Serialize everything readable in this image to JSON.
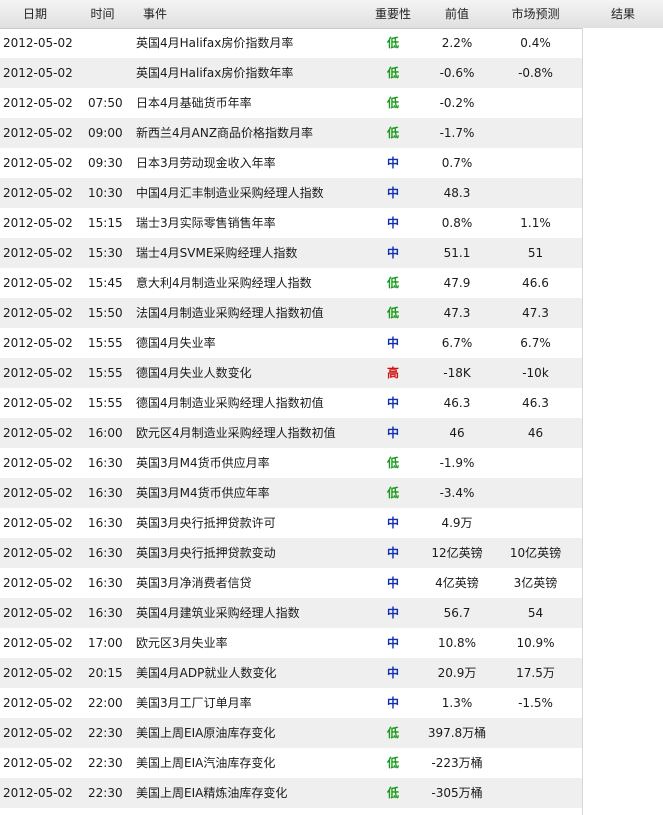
{
  "header": {
    "date": "日期",
    "time": "时间",
    "event": "事件",
    "importance": "重要性",
    "previous": "前值",
    "forecast": "市场预测",
    "result": "结果"
  },
  "colors": {
    "low": "#1a9a1a",
    "mid": "#1030b0",
    "high": "#d01010",
    "row_alt": "#efefef"
  },
  "rows": [
    {
      "date": "2012-05-02",
      "time": "",
      "event": "英国4月Halifax房价指数月率",
      "importance": "低",
      "level": "low",
      "previous": "2.2%",
      "forecast": "0.4%"
    },
    {
      "date": "2012-05-02",
      "time": "",
      "event": "英国4月Halifax房价指数年率",
      "importance": "低",
      "level": "low",
      "previous": "-0.6%",
      "forecast": "-0.8%"
    },
    {
      "date": "2012-05-02",
      "time": "07:50",
      "event": "日本4月基础货币年率",
      "importance": "低",
      "level": "low",
      "previous": "-0.2%",
      "forecast": ""
    },
    {
      "date": "2012-05-02",
      "time": "09:00",
      "event": "新西兰4月ANZ商品价格指数月率",
      "importance": "低",
      "level": "low",
      "previous": "-1.7%",
      "forecast": ""
    },
    {
      "date": "2012-05-02",
      "time": "09:30",
      "event": "日本3月劳动现金收入年率",
      "importance": "中",
      "level": "mid",
      "previous": "0.7%",
      "forecast": ""
    },
    {
      "date": "2012-05-02",
      "time": "10:30",
      "event": "中国4月汇丰制造业采购经理人指数",
      "importance": "中",
      "level": "mid",
      "previous": "48.3",
      "forecast": ""
    },
    {
      "date": "2012-05-02",
      "time": "15:15",
      "event": "瑞士3月实际零售销售年率",
      "importance": "中",
      "level": "mid",
      "previous": "0.8%",
      "forecast": "1.1%"
    },
    {
      "date": "2012-05-02",
      "time": "15:30",
      "event": "瑞士4月SVME采购经理人指数",
      "importance": "中",
      "level": "mid",
      "previous": "51.1",
      "forecast": "51"
    },
    {
      "date": "2012-05-02",
      "time": "15:45",
      "event": "意大利4月制造业采购经理人指数",
      "importance": "低",
      "level": "low",
      "previous": "47.9",
      "forecast": "46.6"
    },
    {
      "date": "2012-05-02",
      "time": "15:50",
      "event": "法国4月制造业采购经理人指数初值",
      "importance": "低",
      "level": "low",
      "previous": "47.3",
      "forecast": "47.3"
    },
    {
      "date": "2012-05-02",
      "time": "15:55",
      "event": "德国4月失业率",
      "importance": "中",
      "level": "mid",
      "previous": "6.7%",
      "forecast": "6.7%"
    },
    {
      "date": "2012-05-02",
      "time": "15:55",
      "event": "德国4月失业人数变化",
      "importance": "高",
      "level": "high",
      "previous": "-18K",
      "forecast": "-10k"
    },
    {
      "date": "2012-05-02",
      "time": "15:55",
      "event": "德国4月制造业采购经理人指数初值",
      "importance": "中",
      "level": "mid",
      "previous": "46.3",
      "forecast": "46.3"
    },
    {
      "date": "2012-05-02",
      "time": "16:00",
      "event": "欧元区4月制造业采购经理人指数初值",
      "importance": "中",
      "level": "mid",
      "previous": "46",
      "forecast": "46"
    },
    {
      "date": "2012-05-02",
      "time": "16:30",
      "event": "英国3月M4货币供应月率",
      "importance": "低",
      "level": "low",
      "previous": "-1.9%",
      "forecast": ""
    },
    {
      "date": "2012-05-02",
      "time": "16:30",
      "event": "英国3月M4货币供应年率",
      "importance": "低",
      "level": "low",
      "previous": "-3.4%",
      "forecast": ""
    },
    {
      "date": "2012-05-02",
      "time": "16:30",
      "event": "英国3月央行抵押贷款许可",
      "importance": "中",
      "level": "mid",
      "previous": "4.9万",
      "forecast": ""
    },
    {
      "date": "2012-05-02",
      "time": "16:30",
      "event": "英国3月央行抵押贷款变动",
      "importance": "中",
      "level": "mid",
      "previous": "12亿英镑",
      "forecast": "10亿英镑"
    },
    {
      "date": "2012-05-02",
      "time": "16:30",
      "event": "英国3月净消费者信贷",
      "importance": "中",
      "level": "mid",
      "previous": "4亿英镑",
      "forecast": "3亿英镑"
    },
    {
      "date": "2012-05-02",
      "time": "16:30",
      "event": "英国4月建筑业采购经理人指数",
      "importance": "中",
      "level": "mid",
      "previous": "56.7",
      "forecast": "54"
    },
    {
      "date": "2012-05-02",
      "time": "17:00",
      "event": "欧元区3月失业率",
      "importance": "中",
      "level": "mid",
      "previous": "10.8%",
      "forecast": "10.9%"
    },
    {
      "date": "2012-05-02",
      "time": "20:15",
      "event": "美国4月ADP就业人数变化",
      "importance": "中",
      "level": "mid",
      "previous": "20.9万",
      "forecast": "17.5万"
    },
    {
      "date": "2012-05-02",
      "time": "22:00",
      "event": "美国3月工厂订单月率",
      "importance": "中",
      "level": "mid",
      "previous": "1.3%",
      "forecast": "-1.5%"
    },
    {
      "date": "2012-05-02",
      "time": "22:30",
      "event": "美国上周EIA原油库存变化",
      "importance": "低",
      "level": "low",
      "previous": "397.8万桶",
      "forecast": ""
    },
    {
      "date": "2012-05-02",
      "time": "22:30",
      "event": "美国上周EIA汽油库存变化",
      "importance": "低",
      "level": "low",
      "previous": "-223万桶",
      "forecast": ""
    },
    {
      "date": "2012-05-02",
      "time": "22:30",
      "event": "美国上周EIA精炼油库存变化",
      "importance": "低",
      "level": "low",
      "previous": "-305万桶",
      "forecast": ""
    }
  ]
}
